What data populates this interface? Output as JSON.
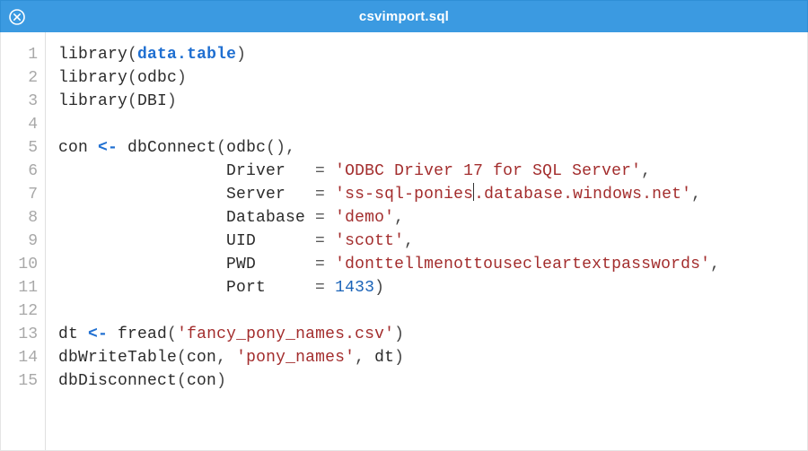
{
  "titlebar": {
    "title": "csvimport.sql",
    "close_label": "Close"
  },
  "colors": {
    "titlebar_bg": "#3b9ae1",
    "keyword": "#1f6fd1",
    "string": "#a32d2d",
    "number": "#1a63b8",
    "gutter": "#a8a8a8"
  },
  "code": {
    "total_lines": 15,
    "lines": [
      {
        "n": "1",
        "tokens": [
          {
            "t": "library",
            "c": "plain"
          },
          {
            "t": "(",
            "c": "punc"
          },
          {
            "t": "data",
            "c": "kw"
          },
          {
            "t": ".",
            "c": "kw"
          },
          {
            "t": "table",
            "c": "kw"
          },
          {
            "t": ")",
            "c": "punc"
          }
        ]
      },
      {
        "n": "2",
        "tokens": [
          {
            "t": "library",
            "c": "plain"
          },
          {
            "t": "(",
            "c": "punc"
          },
          {
            "t": "odbc",
            "c": "plain"
          },
          {
            "t": ")",
            "c": "punc"
          }
        ]
      },
      {
        "n": "3",
        "tokens": [
          {
            "t": "library",
            "c": "plain"
          },
          {
            "t": "(",
            "c": "punc"
          },
          {
            "t": "DBI",
            "c": "plain"
          },
          {
            "t": ")",
            "c": "punc"
          }
        ]
      },
      {
        "n": "4",
        "tokens": []
      },
      {
        "n": "5",
        "tokens": [
          {
            "t": "con ",
            "c": "plain"
          },
          {
            "t": "<-",
            "c": "kw"
          },
          {
            "t": " dbConnect",
            "c": "plain"
          },
          {
            "t": "(",
            "c": "punc"
          },
          {
            "t": "odbc",
            "c": "plain"
          },
          {
            "t": "()",
            "c": "punc"
          },
          {
            "t": ",",
            "c": "punc"
          }
        ]
      },
      {
        "n": "6",
        "tokens": [
          {
            "t": "                 Driver   ",
            "c": "plain"
          },
          {
            "t": "=",
            "c": "op"
          },
          {
            "t": " ",
            "c": "plain"
          },
          {
            "t": "'ODBC Driver 17 for SQL Server'",
            "c": "str"
          },
          {
            "t": ",",
            "c": "punc"
          }
        ]
      },
      {
        "n": "7",
        "tokens": [
          {
            "t": "                 Server   ",
            "c": "plain"
          },
          {
            "t": "=",
            "c": "op"
          },
          {
            "t": " ",
            "c": "plain"
          },
          {
            "t": "'ss-sql-ponies",
            "c": "str"
          },
          {
            "t": "",
            "c": "cursor"
          },
          {
            "t": ".database.windows.net'",
            "c": "str"
          },
          {
            "t": ",",
            "c": "punc"
          }
        ]
      },
      {
        "n": "8",
        "tokens": [
          {
            "t": "                 Database ",
            "c": "plain"
          },
          {
            "t": "=",
            "c": "op"
          },
          {
            "t": " ",
            "c": "plain"
          },
          {
            "t": "'demo'",
            "c": "str"
          },
          {
            "t": ",",
            "c": "punc"
          }
        ]
      },
      {
        "n": "9",
        "tokens": [
          {
            "t": "                 UID      ",
            "c": "plain"
          },
          {
            "t": "=",
            "c": "op"
          },
          {
            "t": " ",
            "c": "plain"
          },
          {
            "t": "'scott'",
            "c": "str"
          },
          {
            "t": ",",
            "c": "punc"
          }
        ]
      },
      {
        "n": "10",
        "tokens": [
          {
            "t": "                 PWD      ",
            "c": "plain"
          },
          {
            "t": "=",
            "c": "op"
          },
          {
            "t": " ",
            "c": "plain"
          },
          {
            "t": "'donttellmenottousecleartextpasswords'",
            "c": "str"
          },
          {
            "t": ",",
            "c": "punc"
          }
        ]
      },
      {
        "n": "11",
        "tokens": [
          {
            "t": "                 Port     ",
            "c": "plain"
          },
          {
            "t": "=",
            "c": "op"
          },
          {
            "t": " ",
            "c": "plain"
          },
          {
            "t": "1433",
            "c": "num"
          },
          {
            "t": ")",
            "c": "punc"
          }
        ]
      },
      {
        "n": "12",
        "tokens": []
      },
      {
        "n": "13",
        "tokens": [
          {
            "t": "dt ",
            "c": "plain"
          },
          {
            "t": "<-",
            "c": "kw"
          },
          {
            "t": " fread",
            "c": "plain"
          },
          {
            "t": "(",
            "c": "punc"
          },
          {
            "t": "'fancy_pony_names.csv'",
            "c": "str"
          },
          {
            "t": ")",
            "c": "punc"
          }
        ]
      },
      {
        "n": "14",
        "tokens": [
          {
            "t": "dbWriteTable",
            "c": "plain"
          },
          {
            "t": "(",
            "c": "punc"
          },
          {
            "t": "con",
            "c": "plain"
          },
          {
            "t": ",",
            "c": "punc"
          },
          {
            "t": " ",
            "c": "plain"
          },
          {
            "t": "'pony_names'",
            "c": "str"
          },
          {
            "t": ",",
            "c": "punc"
          },
          {
            "t": " dt",
            "c": "plain"
          },
          {
            "t": ")",
            "c": "punc"
          }
        ]
      },
      {
        "n": "15",
        "tokens": [
          {
            "t": "dbDisconnect",
            "c": "plain"
          },
          {
            "t": "(",
            "c": "punc"
          },
          {
            "t": "con",
            "c": "plain"
          },
          {
            "t": ")",
            "c": "punc"
          }
        ]
      }
    ]
  }
}
